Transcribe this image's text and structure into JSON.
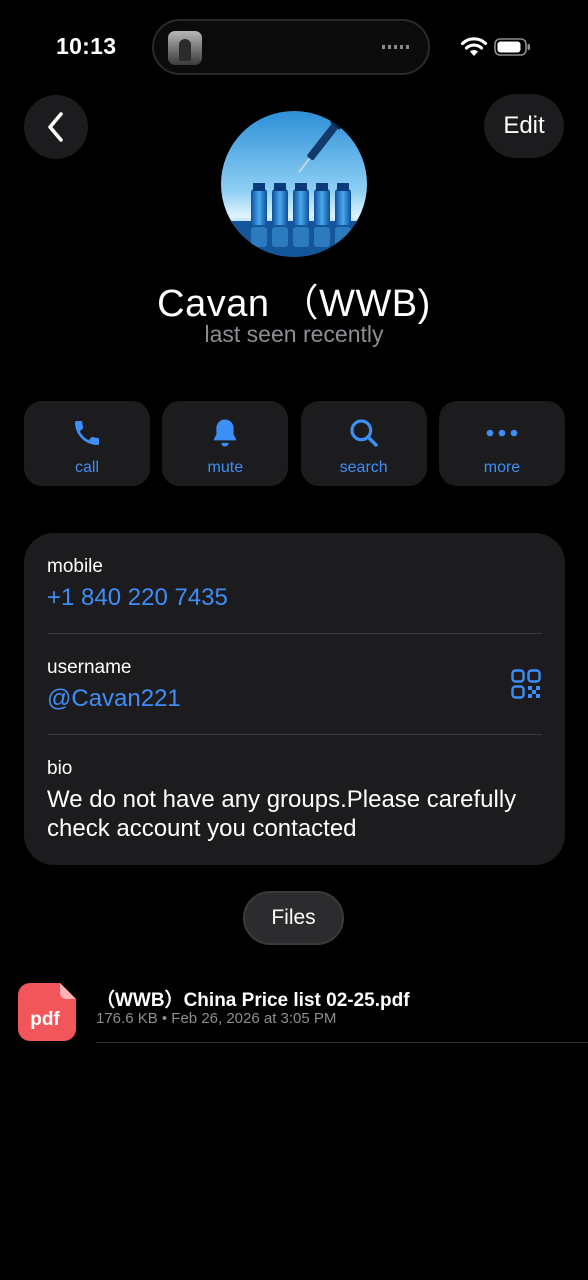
{
  "status_bar": {
    "time": "10:13"
  },
  "nav": {
    "back_icon": "chevron-left-icon",
    "edit_label": "Edit"
  },
  "profile": {
    "name": "Cavan （WWB)",
    "status": "last seen recently"
  },
  "actions": [
    {
      "label": "call",
      "icon": "phone-icon"
    },
    {
      "label": "mute",
      "icon": "bell-icon"
    },
    {
      "label": "search",
      "icon": "search-icon"
    },
    {
      "label": "more",
      "icon": "more-icon"
    }
  ],
  "info": {
    "mobile_label": "mobile",
    "mobile_value": "+1 840 220 7435",
    "username_label": "username",
    "username_value": "@Cavan221",
    "bio_label": "bio",
    "bio_value": "We do not have any groups.Please carefully check account you contacted"
  },
  "files_tab": {
    "label": "Files"
  },
  "files": [
    {
      "icon_text": "pdf",
      "name": "（WWB）China Price list 02-25.pdf",
      "meta": "176.6 KB • Feb 26, 2026 at 3:05 PM"
    }
  ],
  "colors": {
    "accent": "#3e8ef7",
    "background": "#000000",
    "card": "#1c1c1e",
    "secondary_text": "#8d8d93",
    "pdf_red": "#f2555a"
  }
}
